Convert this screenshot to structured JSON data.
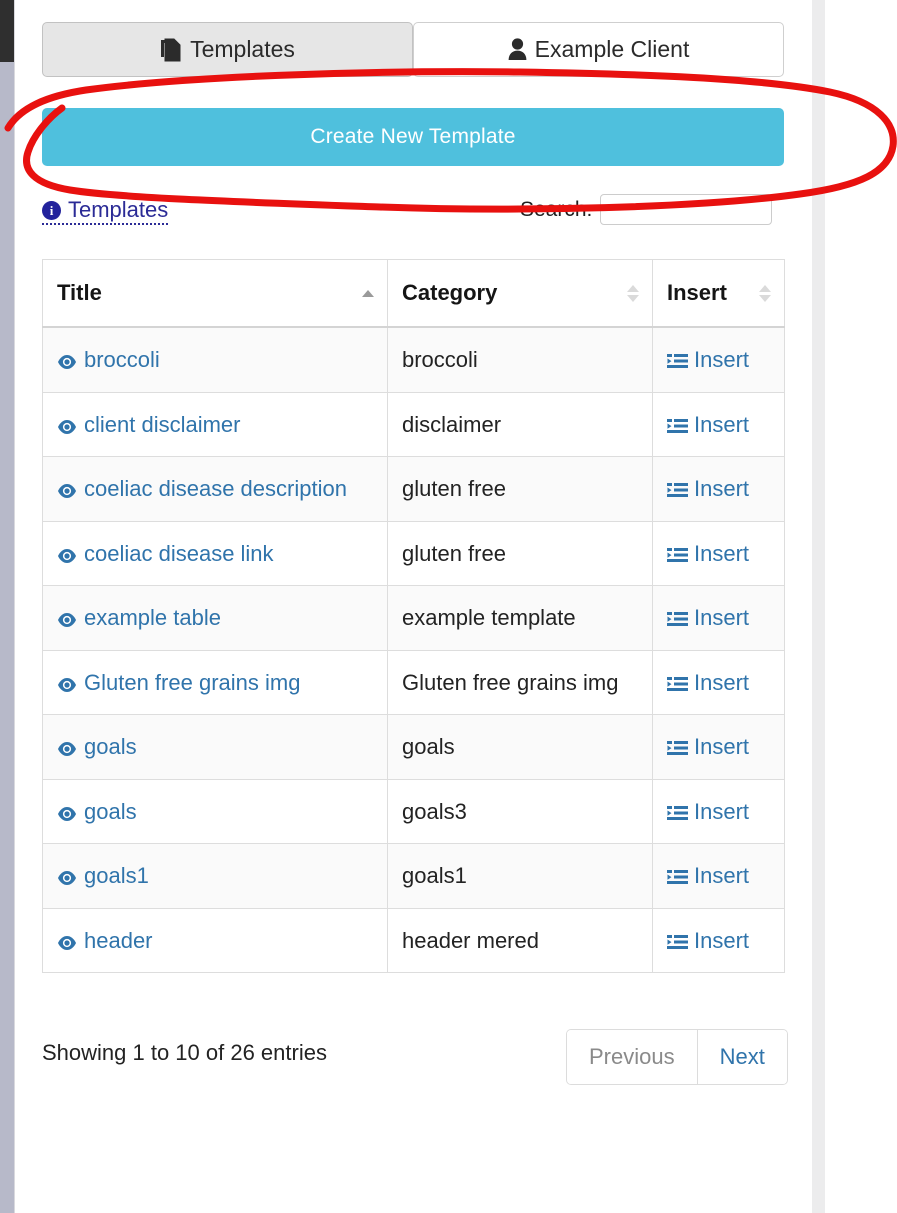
{
  "tabs": [
    {
      "label": "Templates",
      "icon": "copy-files-icon",
      "active": true
    },
    {
      "label": "Example Client",
      "icon": "user-icon",
      "active": false
    }
  ],
  "primary_button": {
    "label": "Create New Template"
  },
  "info_link": {
    "label": "Templates",
    "icon": "info-circle-icon"
  },
  "search": {
    "label": "Search:",
    "value": "",
    "placeholder": ""
  },
  "table": {
    "columns": [
      {
        "label": "Title",
        "sort": "asc"
      },
      {
        "label": "Category",
        "sort": "none"
      },
      {
        "label": "Insert",
        "sort": "none"
      }
    ],
    "row_action_label": "Insert",
    "rows": [
      {
        "title": "broccoli",
        "category": "broccoli",
        "insert": "Insert"
      },
      {
        "title": "client disclaimer",
        "category": "disclaimer",
        "insert": "Insert"
      },
      {
        "title": "coeliac disease description",
        "category": "gluten free",
        "insert": "Insert"
      },
      {
        "title": "coeliac disease link",
        "category": "gluten free",
        "insert": "Insert"
      },
      {
        "title": "example table",
        "category": "example template",
        "insert": "Insert"
      },
      {
        "title": "Gluten free grains img",
        "category": "Gluten free grains img",
        "insert": "Insert"
      },
      {
        "title": "goals",
        "category": "goals",
        "insert": "Insert"
      },
      {
        "title": "goals",
        "category": "goals3",
        "insert": "Insert"
      },
      {
        "title": "goals1",
        "category": "goals1",
        "insert": "Insert"
      },
      {
        "title": "header",
        "category": "header mered",
        "insert": "Insert"
      }
    ]
  },
  "footer": {
    "info": "Showing 1 to 10 of 26 entries",
    "previous_label": "Previous",
    "next_label": "Next"
  },
  "colors": {
    "primary_button": "#4fc0dd",
    "link": "#3074ab",
    "info_link": "#2b2b96",
    "annotation": "#e8110f",
    "active_tab_bg": "#e6e6e6"
  }
}
